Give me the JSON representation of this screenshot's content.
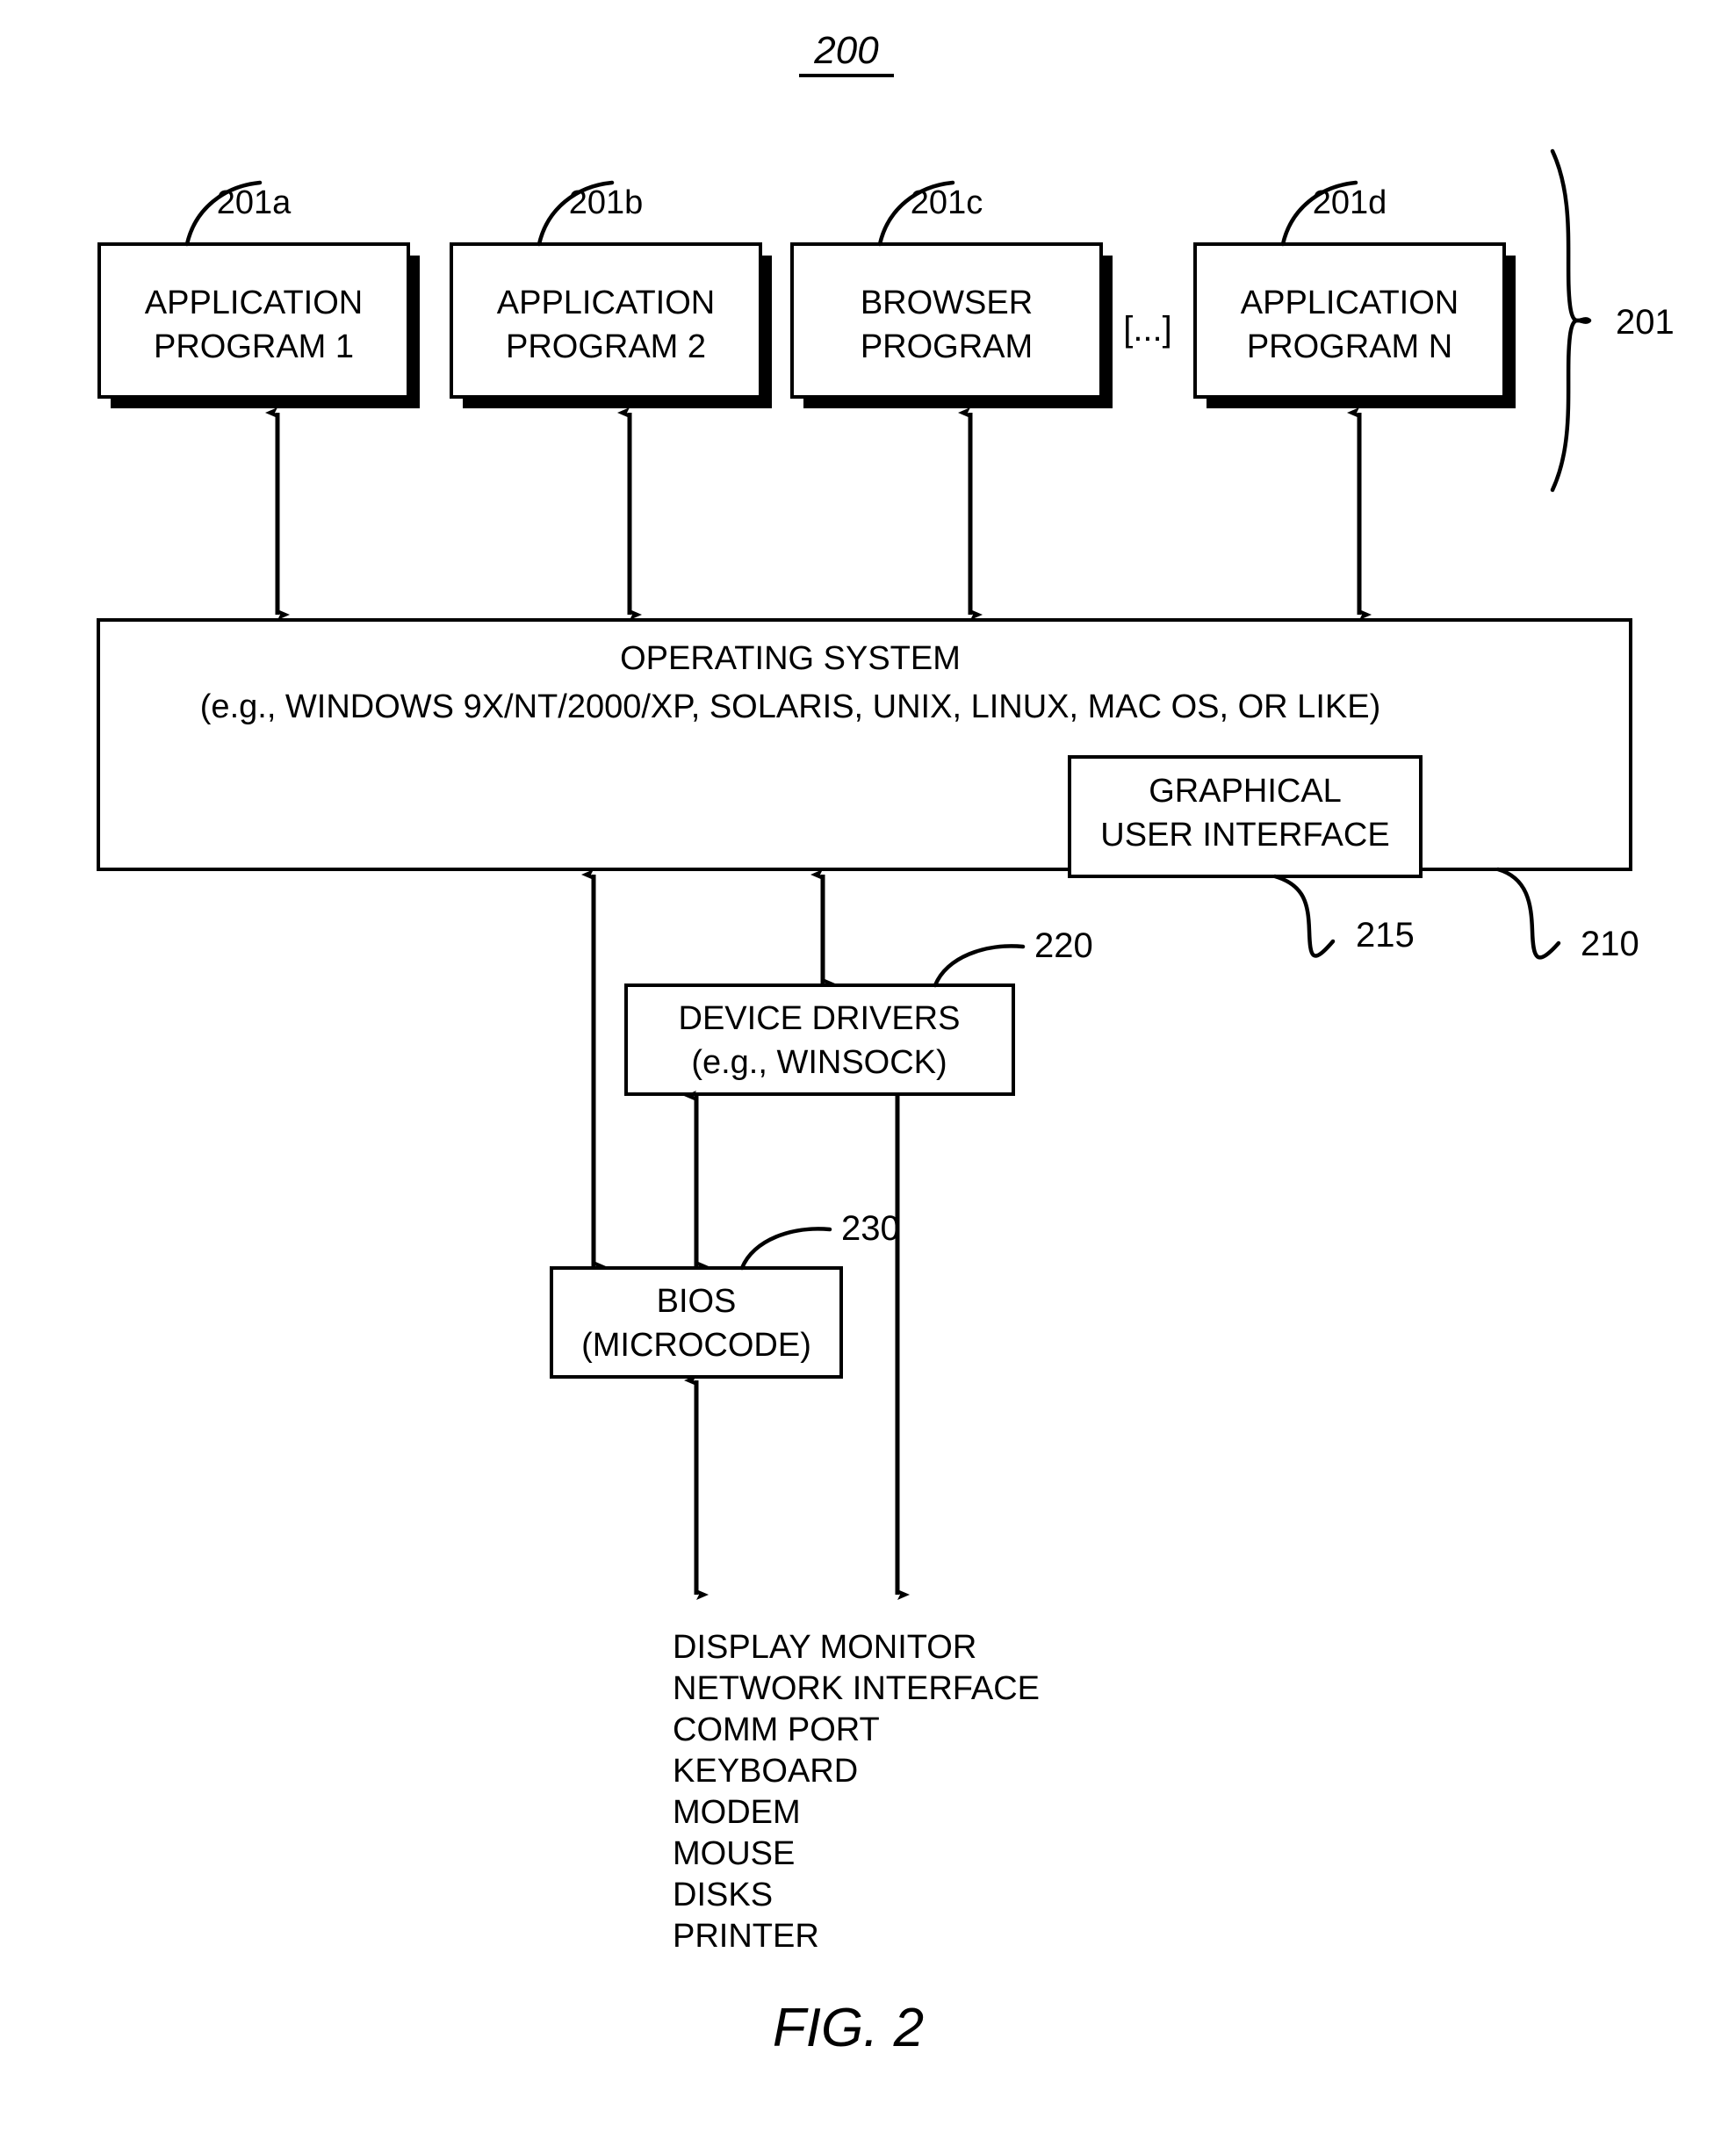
{
  "figure": {
    "number_label": "200",
    "caption": "FIG. 2"
  },
  "application_layer": {
    "group_ref": "201",
    "ellipsis": "[...]",
    "boxes": [
      {
        "ref": "201a",
        "line1": "APPLICATION",
        "line2": "PROGRAM 1"
      },
      {
        "ref": "201b",
        "line1": "APPLICATION",
        "line2": "PROGRAM 2"
      },
      {
        "ref": "201c",
        "line1": "BROWSER",
        "line2": "PROGRAM"
      },
      {
        "ref": "201d",
        "line1": "APPLICATION",
        "line2": "PROGRAM N"
      }
    ]
  },
  "operating_system": {
    "ref": "210",
    "line1": "OPERATING SYSTEM",
    "line2": "(e.g., WINDOWS 9X/NT/2000/XP, SOLARIS, UNIX, LINUX, MAC OS, OR LIKE)",
    "gui": {
      "ref": "215",
      "line1": "GRAPHICAL",
      "line2": "USER INTERFACE"
    }
  },
  "device_drivers": {
    "ref": "220",
    "line1": "DEVICE DRIVERS",
    "line2": "(e.g., WINSOCK)"
  },
  "bios": {
    "ref": "230",
    "line1": "BIOS",
    "line2": "(MICROCODE)"
  },
  "devices": {
    "items": [
      "DISPLAY MONITOR",
      "NETWORK INTERFACE",
      "COMM PORT",
      "KEYBOARD",
      "MODEM",
      "MOUSE",
      "DISKS",
      "PRINTER"
    ]
  },
  "colors": {
    "ink": "#000000",
    "paper": "#ffffff"
  }
}
